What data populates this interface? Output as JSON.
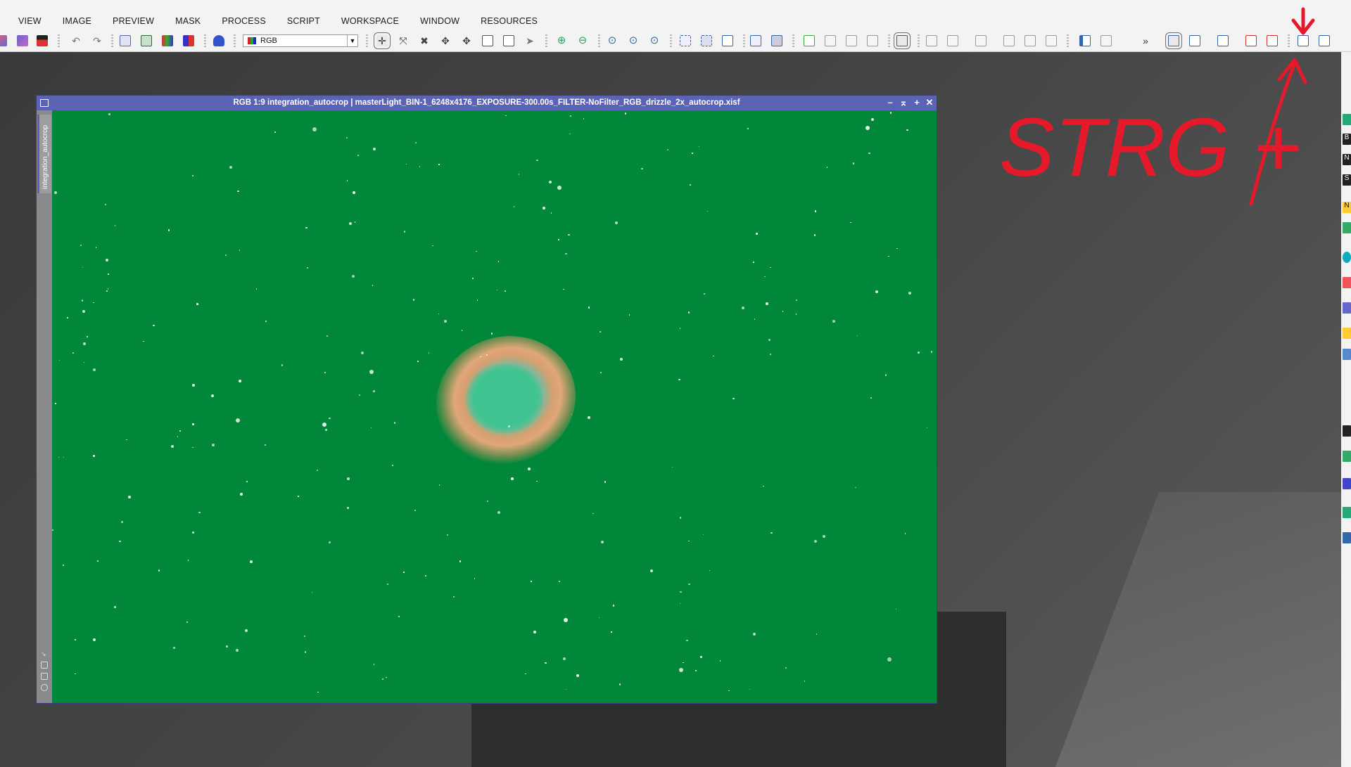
{
  "menu": [
    "VIEW",
    "IMAGE",
    "PREVIEW",
    "MASK",
    "PROCESS",
    "SCRIPT",
    "WORKSPACE",
    "WINDOW",
    "RESOURCES"
  ],
  "toolbar": {
    "color_mode": "RGB",
    "overflow_label": "»"
  },
  "image_window": {
    "title": "RGB 1:9 integration_autocrop | masterLight_BIN-1_6248x4176_EXPOSURE-300.00s_FILTER-NoFilter_RGB_drizzle_2x_autocrop.xisf",
    "side_tab_label": "integration_autocrop",
    "buttons": {
      "minimize": "–",
      "shade": "⌅",
      "maximize": "+",
      "close": "✕"
    }
  },
  "right_dock_labels": [
    "B",
    "N",
    "S",
    "N"
  ],
  "annotation": {
    "text": "STRG +",
    "color": "#e5192a"
  },
  "colors": {
    "image_background": "#00873a",
    "window_frame": "#5b63b6"
  }
}
